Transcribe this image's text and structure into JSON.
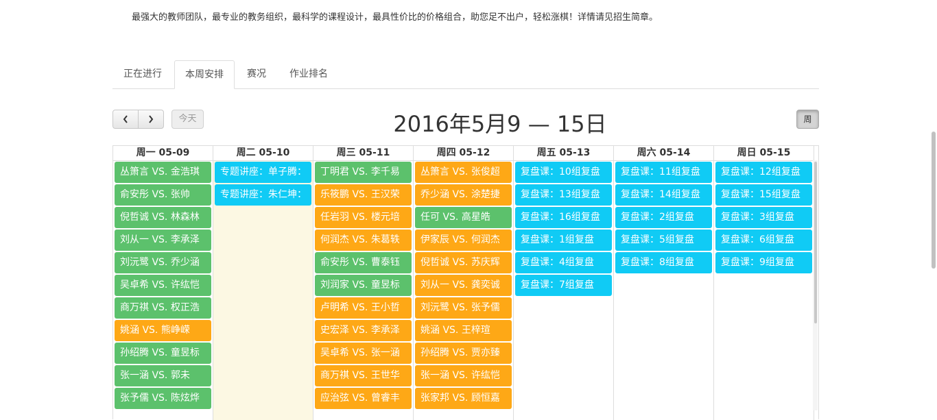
{
  "intro": "最强大的教师团队，最专业的教务组织，最科学的课程设计，最具性价比的价格组合，助您足不出户，轻松涨棋！详情请见招生简章。",
  "tabs": [
    "正在进行",
    "本周安排",
    "赛况",
    "作业排名"
  ],
  "active_tab": "本周安排",
  "toolbar": {
    "prev": "‹",
    "next": "›",
    "today": "今天",
    "title": "2016年5月9 — 15日",
    "week": "周"
  },
  "colors": {
    "green": "#5cc16c",
    "orange": "#fea816",
    "blue": "#10cbf5",
    "today_bg": "#fcf8e3"
  },
  "days": [
    {
      "header": "周一 05-09",
      "events": [
        {
          "text": "丛箫言 VS. 金浩琪",
          "color": "green"
        },
        {
          "text": "俞安彤 VS. 张帅",
          "color": "green"
        },
        {
          "text": "倪哲诚 VS. 林森林",
          "color": "green"
        },
        {
          "text": "刘从一 VS. 李承泽",
          "color": "green"
        },
        {
          "text": "刘沅鹭 VS. 乔少涵",
          "color": "green"
        },
        {
          "text": "吴卓希 VS. 许纮恺",
          "color": "green"
        },
        {
          "text": "商万祺 VS. 权正浩",
          "color": "green"
        },
        {
          "text": "姚涵 VS. 熊峥嵘",
          "color": "orange"
        },
        {
          "text": "孙绍腾 VS. 童昱标",
          "color": "green"
        },
        {
          "text": "张一涵 VS. 郭未",
          "color": "green"
        },
        {
          "text": "张予儒 VS. 陈炫烨",
          "color": "green"
        }
      ]
    },
    {
      "header": "周二 05-10",
      "today": true,
      "events": [
        {
          "text": "专题讲座：单子腾：",
          "color": "blue"
        },
        {
          "text": "专题讲座：朱仁坤：",
          "color": "blue"
        }
      ]
    },
    {
      "header": "周三 05-11",
      "events": [
        {
          "text": "丁明君 VS. 李千易",
          "color": "green"
        },
        {
          "text": "乐筱鹏 VS. 王汉荣",
          "color": "orange"
        },
        {
          "text": "任岩羽 VS. 楼元培",
          "color": "orange"
        },
        {
          "text": "何润杰 VS. 朱葛轶",
          "color": "orange"
        },
        {
          "text": "俞安彤 VS. 曹泰钰",
          "color": "green"
        },
        {
          "text": "刘润家 VS. 童昱标",
          "color": "green"
        },
        {
          "text": "卢明希 VS. 王小哲",
          "color": "orange"
        },
        {
          "text": "史宏泽 VS. 李承泽",
          "color": "orange"
        },
        {
          "text": "吴卓希 VS. 张一涵",
          "color": "orange"
        },
        {
          "text": "商万祺 VS. 王世华",
          "color": "orange"
        },
        {
          "text": "应治弦 VS. 曾睿丰",
          "color": "orange"
        }
      ]
    },
    {
      "header": "周四 05-12",
      "events": [
        {
          "text": "丛箫言 VS. 张俊超",
          "color": "orange"
        },
        {
          "text": "乔少涵 VS. 涂楚捷",
          "color": "orange"
        },
        {
          "text": "任可 VS. 高星皓",
          "color": "green"
        },
        {
          "text": "伊家辰 VS. 何润杰",
          "color": "orange"
        },
        {
          "text": "倪哲诚 VS. 苏庆辉",
          "color": "orange"
        },
        {
          "text": "刘从一 VS. 龚奕诚",
          "color": "orange"
        },
        {
          "text": "刘沅鹭 VS. 张予儒",
          "color": "orange"
        },
        {
          "text": "姚涵 VS. 王梓瑄",
          "color": "orange"
        },
        {
          "text": "孙绍腾 VS. 贾亦臻",
          "color": "orange"
        },
        {
          "text": "张一涵 VS. 许纮恺",
          "color": "orange"
        },
        {
          "text": "张家邦 VS. 顾恒嘉",
          "color": "orange"
        }
      ]
    },
    {
      "header": "周五 05-13",
      "events": [
        {
          "text": "复盘课：10组复盘",
          "color": "blue"
        },
        {
          "text": "复盘课：13组复盘",
          "color": "blue"
        },
        {
          "text": "复盘课：16组复盘",
          "color": "blue"
        },
        {
          "text": "复盘课：1组复盘",
          "color": "blue"
        },
        {
          "text": "复盘课：4组复盘",
          "color": "blue"
        },
        {
          "text": "复盘课：7组复盘",
          "color": "blue"
        }
      ]
    },
    {
      "header": "周六 05-14",
      "events": [
        {
          "text": "复盘课：11组复盘",
          "color": "blue"
        },
        {
          "text": "复盘课：14组复盘",
          "color": "blue"
        },
        {
          "text": "复盘课：2组复盘",
          "color": "blue"
        },
        {
          "text": "复盘课：5组复盘",
          "color": "blue"
        },
        {
          "text": "复盘课：8组复盘",
          "color": "blue"
        }
      ]
    },
    {
      "header": "周日 05-15",
      "events": [
        {
          "text": "复盘课：12组复盘",
          "color": "blue"
        },
        {
          "text": "复盘课：15组复盘",
          "color": "blue"
        },
        {
          "text": "复盘课：3组复盘",
          "color": "blue"
        },
        {
          "text": "复盘课：6组复盘",
          "color": "blue"
        },
        {
          "text": "复盘课：9组复盘",
          "color": "blue"
        }
      ]
    }
  ]
}
